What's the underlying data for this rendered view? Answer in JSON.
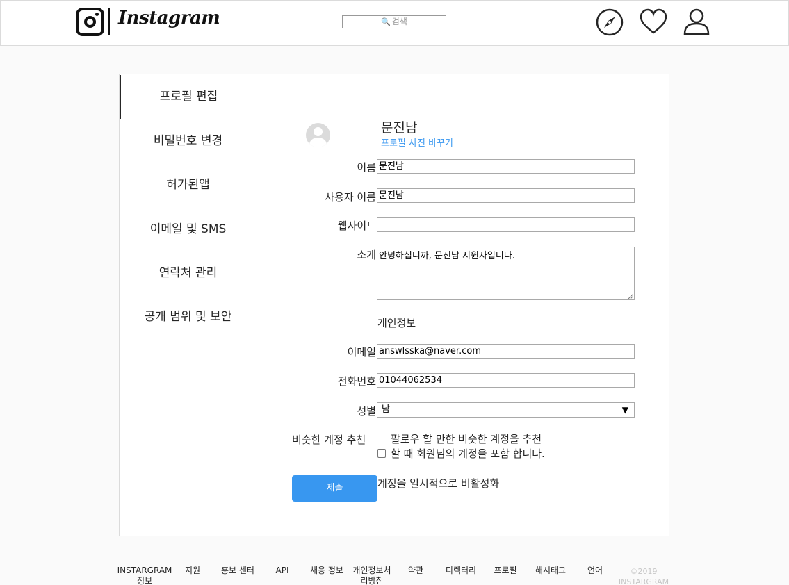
{
  "header": {
    "logo_text": "Instagram",
    "search_placeholder": "검색",
    "icons": [
      "compass-icon",
      "heart-icon",
      "person-icon"
    ]
  },
  "sidebar": {
    "items": [
      {
        "label": "프로필 편집",
        "active": true
      },
      {
        "label": "비밀번호 변경"
      },
      {
        "label": "허가된앱"
      },
      {
        "label": "이메일 및 SMS"
      },
      {
        "label": "연락처 관리"
      },
      {
        "label": "공개 범위 및 보안"
      }
    ]
  },
  "profile": {
    "username": "문진남",
    "change_photo": "프로필 사진 바꾸기"
  },
  "form": {
    "name_label": "이름",
    "name_value": "문진남",
    "user_label": "사용자 이름",
    "user_value": "문진남",
    "website_label": "웹사이트",
    "website_value": "",
    "bio_label": "소개",
    "bio_value": "안녕하십니까, 문진남 지원자입니다.",
    "private_info_title": "개인정보",
    "email_label": "이메일",
    "email_value": "answlsska@naver.com",
    "phone_label": "전화번호",
    "phone_value": "01044062534",
    "gender_label": "성별",
    "gender_value": "남",
    "similar_label": "비슷한 계정 추천",
    "similar_desc": "팔로우 할 만한 비슷한 계정을 추천할 때 회원님의 계정을 포함 합니다.",
    "similar_checked": false,
    "submit_label": "제출",
    "deactivate_label": "계정을 일시적으로 비활성화"
  },
  "footer": {
    "links": [
      "INSTARGRAM 정보",
      "지원",
      "홍보 센터",
      "API",
      "채용 정보",
      "개인정보처리방침",
      "약관",
      "디렉터리",
      "프로필",
      "해시태그",
      "언어"
    ],
    "copyright": "©2019 INSTARGRAM"
  },
  "colors": {
    "accent": "#3897f0",
    "border": "#dbdbdb",
    "background": "#fafafa"
  }
}
